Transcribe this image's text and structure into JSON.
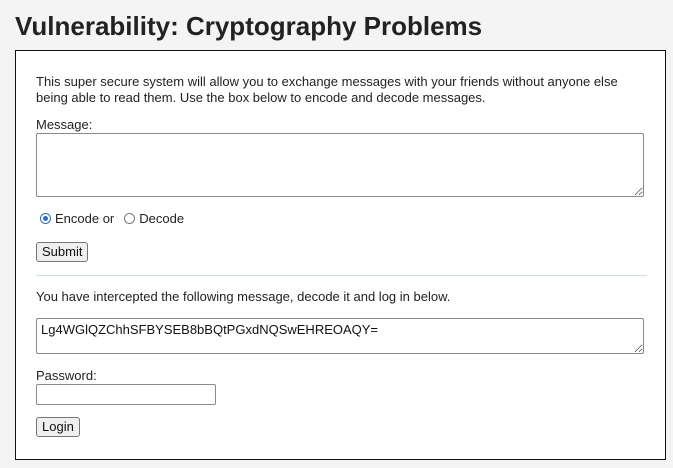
{
  "page": {
    "title": "Vulnerability: Cryptography Problems"
  },
  "panel": {
    "intro": "This super secure system will allow you to exchange messages with your friends without anyone else being able to read them. Use the box below to encode and decode messages.",
    "message_label": "Message:",
    "message_value": "",
    "mode_options": [
      {
        "label": "Encode or",
        "checked": true
      },
      {
        "label": "Decode",
        "checked": false
      }
    ],
    "submit_label": "Submit",
    "intercept_text": "You have intercepted the following message, decode it and log in below.",
    "intercepted_message": "Lg4WGlQZChhSFBYSEB8bBQtPGxdNQSwEHREOAQY=",
    "password_label": "Password:",
    "password_value": "",
    "login_label": "Login"
  },
  "colors": {
    "radio_accent": "#2a6ec8",
    "separator": "#c8dce9",
    "page_background": "#f4f4f4"
  }
}
